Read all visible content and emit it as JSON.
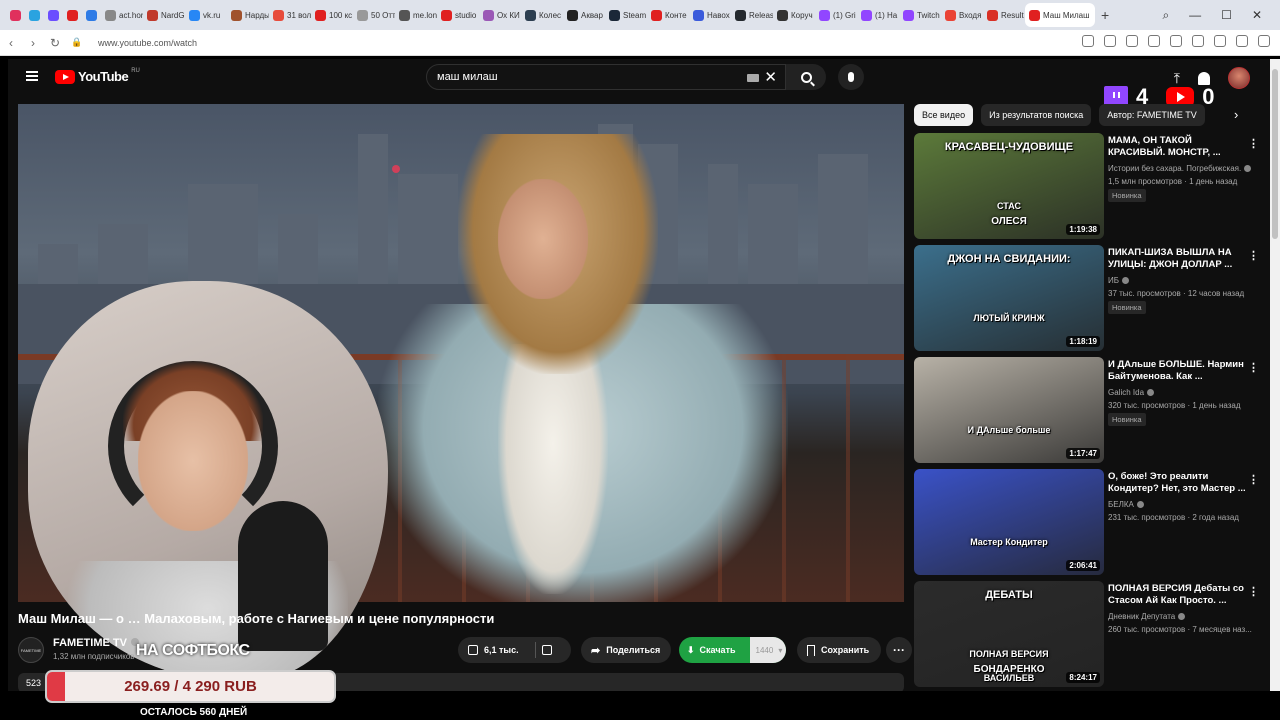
{
  "browser": {
    "tabs": [
      {
        "label": "",
        "color": "#e0305d"
      },
      {
        "label": "",
        "color": "#2aa3e0"
      },
      {
        "label": "",
        "color": "#6b4eff"
      },
      {
        "label": "",
        "color": "#e02020"
      },
      {
        "label": "",
        "color": "#2e7be6"
      },
      {
        "label": "act.hor",
        "color": "#888888"
      },
      {
        "label": "NardG",
        "color": "#c0392b"
      },
      {
        "label": "vk.ru",
        "color": "#2787f5"
      },
      {
        "label": "Нарды",
        "color": "#a0522d"
      },
      {
        "label": "31 вол",
        "color": "#e74c3c"
      },
      {
        "label": "100 кс",
        "color": "#e02020"
      },
      {
        "label": "50 Отт",
        "color": "#999999"
      },
      {
        "label": "me.lon",
        "color": "#555555"
      },
      {
        "label": "studio",
        "color": "#e02020"
      },
      {
        "label": "Ох КИ",
        "color": "#9b59b6"
      },
      {
        "label": "Колес",
        "color": "#2c3e50"
      },
      {
        "label": "Аквар",
        "color": "#222222"
      },
      {
        "label": "Steam",
        "color": "#1b2838"
      },
      {
        "label": "Конте",
        "color": "#e02020"
      },
      {
        "label": "Навох",
        "color": "#3b5bdb"
      },
      {
        "label": "Releas",
        "color": "#24292e"
      },
      {
        "label": "Коруч",
        "color": "#333333"
      },
      {
        "label": "(1) Gri",
        "color": "#9146ff"
      },
      {
        "label": "(1) На",
        "color": "#9146ff"
      },
      {
        "label": "Twitch",
        "color": "#9146ff"
      },
      {
        "label": "Входя",
        "color": "#ea4335"
      },
      {
        "label": "Result",
        "color": "#d93025"
      }
    ],
    "active_tab": {
      "label": "Маш Милаш",
      "color": "#e02020"
    },
    "new_tab": "+",
    "window_controls": {
      "search": "⌕",
      "minimize": "—",
      "maximize": "☐",
      "close": "✕"
    },
    "nav": {
      "back": "‹",
      "forward": "›",
      "reload": "↻"
    },
    "url": "www.youtube.com/watch"
  },
  "youtube": {
    "logo_text": "YouTube",
    "region": "RU",
    "search_value": "маш милаш",
    "clear": "✕",
    "upload_icon": "⤒",
    "overlay": {
      "twitch_count": "4",
      "youtube_count": "0"
    },
    "video": {
      "title": "Маш Милаш — о … Малаховым, работе с Нагиевым и цене популярности",
      "channel": "FAMETIME TV",
      "channel_logo": "FAMETIME",
      "subscribers": "1,32 млн подписчиков",
      "likes": "6,1 тыс.",
      "share": "Поделиться",
      "download": "Скачать",
      "quality": "1440",
      "save": "Сохранить",
      "more": "···",
      "desc_prefix": "523"
    },
    "stream_overlay_text": "НА СОФТБОКС",
    "chips": [
      "Все видео",
      "Из результатов поиска",
      "Автор: FAMETIME TV"
    ],
    "chip_next": "›",
    "recommendations": [
      {
        "title": "МАМА, ОН ТАКОЙ КРАСИВЫЙ. МОНСТР, ...",
        "channel": "Истории без сахара. Погребижская.",
        "views": "1,5 млн просмотров · 1 день назад",
        "badge": "Новинка",
        "duration": "1:19:38",
        "caption": "КРАСАВЕЦ-ЧУДОВИЩЕ",
        "labels": [
          "СТАС",
          "ОЛЕСЯ"
        ],
        "bg": "#5c7a3a"
      },
      {
        "title": "ПИКАП-ШИЗА ВЫШЛА НА УЛИЦЫ: ДЖОН ДОЛЛАР ...",
        "channel": "ИБ",
        "views": "37 тыс. просмотров · 12 часов назад",
        "badge": "Новинка",
        "duration": "1:18:19",
        "caption": "ДЖОН НА СВИДАНИИ:",
        "labels": [
          "ЛЮТЫЙ КРИНЖ"
        ],
        "bg": "#3b6f8c"
      },
      {
        "title": "И ДАльше БОЛЬШЕ. Нармин Байтуменова. Как ...",
        "channel": "Galich Ida",
        "views": "320 тыс. просмотров · 1 день назад",
        "badge": "Новинка",
        "duration": "1:17:47",
        "caption": "",
        "labels": [
          "И ДАльше больше"
        ],
        "bg": "#b8b2a7"
      },
      {
        "title": "О, боже! Это реалити Кондитер? Нет, это Мастер ...",
        "channel": "БЕЛКА",
        "views": "231 тыс. просмотров · 2 года назад",
        "badge": "",
        "duration": "2:06:41",
        "caption": "",
        "labels": [
          "Мастер Кондитер"
        ],
        "bg": "#3a52c8"
      },
      {
        "title": "ПОЛНАЯ ВЕРСИЯ Дебаты со Стасом Ай Как Просто. ...",
        "channel": "Дневник Депутата",
        "views": "260 тыс. просмотров · 7 месяцев наз...",
        "badge": "",
        "duration": "8:24:17",
        "caption": "ДЕБАТЫ",
        "labels": [
          "ПОЛНАЯ ВЕРСИЯ",
          "БОНДАРЕНКО",
          "ВАСИЛЬЕВ"
        ],
        "bg": "#2b2b2b"
      }
    ],
    "menu_dots": "⋮"
  },
  "donation": {
    "text": "269.69 / 4 290 RUB",
    "progress": 0.063,
    "fill_color": "#e03a45",
    "days_left": "ОСТАЛОСЬ 560 ДНЕЙ"
  }
}
